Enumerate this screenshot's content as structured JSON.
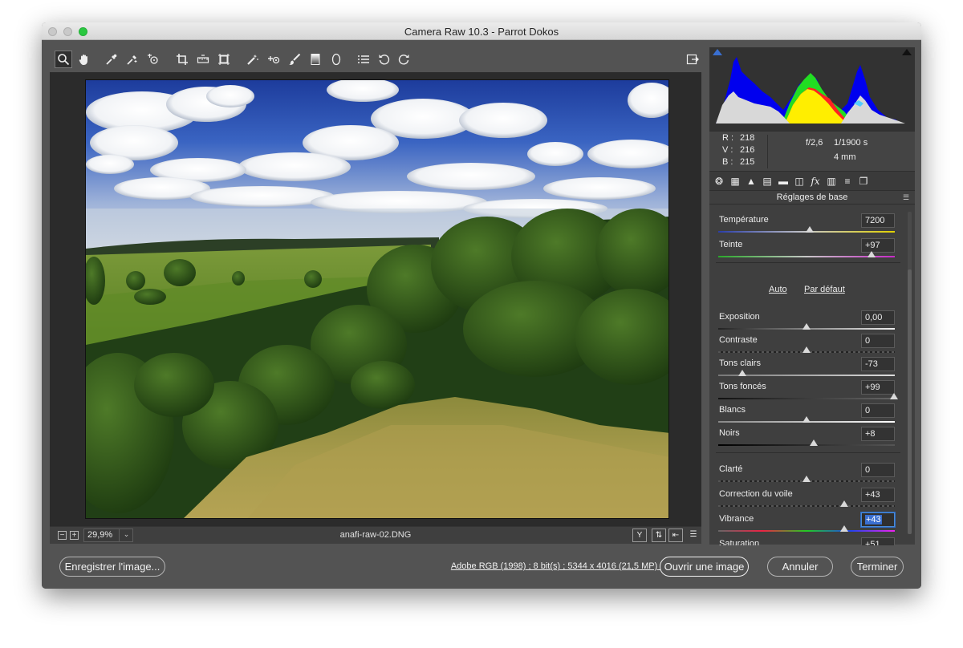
{
  "window": {
    "title": "Camera Raw 10.3  -  Parrot Dokos"
  },
  "toolbar": {
    "tools": [
      "zoom-tool",
      "hand-tool",
      "white-balance-tool",
      "color-sampler-tool",
      "targeted-adjustment-tool",
      "crop-tool",
      "straighten-tool",
      "transform-tool",
      "spot-removal-tool",
      "red-eye-removal-tool",
      "adjustment-brush-tool",
      "graduated-filter-tool",
      "radial-filter-tool",
      "preferences-tool",
      "rotate-ccw-tool",
      "rotate-cw-tool"
    ],
    "active_tool": "zoom-tool"
  },
  "statusbar": {
    "zoom": "29,9%",
    "filename": "anafi-raw-02.DNG"
  },
  "histogram": {
    "rgb": {
      "r_label": "R :",
      "r": "218",
      "v_label": "V :",
      "v": "216",
      "b_label": "B :",
      "b": "215"
    },
    "aperture": "f/2,6",
    "shutter": "1/1900 s",
    "focal": "4 mm"
  },
  "panel": {
    "section_title": "Réglages de base",
    "auto_label": "Auto",
    "default_label": "Par défaut",
    "sliders": [
      {
        "label": "Température",
        "value": "7200"
      },
      {
        "label": "Teinte",
        "value": "+97"
      },
      {
        "label": "Exposition",
        "value": "0,00"
      },
      {
        "label": "Contraste",
        "value": "0"
      },
      {
        "label": "Tons clairs",
        "value": "-73"
      },
      {
        "label": "Tons foncés",
        "value": "+99"
      },
      {
        "label": "Blancs",
        "value": "0"
      },
      {
        "label": "Noirs",
        "value": "+8"
      },
      {
        "label": "Clarté",
        "value": "0"
      },
      {
        "label": "Correction du voile",
        "value": "+43"
      },
      {
        "label": "Vibrance",
        "value": "+43"
      },
      {
        "label": "Saturation",
        "value": "+51"
      }
    ]
  },
  "bottombar": {
    "save_label": "Enregistrer l'image...",
    "workflow_info": "Adobe RGB (1998) ; 8 bit(s) ; 5344 x 4016 (21,5 MP) ; 300 ppp",
    "open_label": "Ouvrir une image",
    "cancel_label": "Annuler",
    "done_label": "Terminer"
  },
  "colors": {
    "window_bg": "#535353",
    "panel_bg": "#3f3f3f",
    "focus_blue": "#3a6fd0",
    "traffic_green": "#2ac840"
  }
}
